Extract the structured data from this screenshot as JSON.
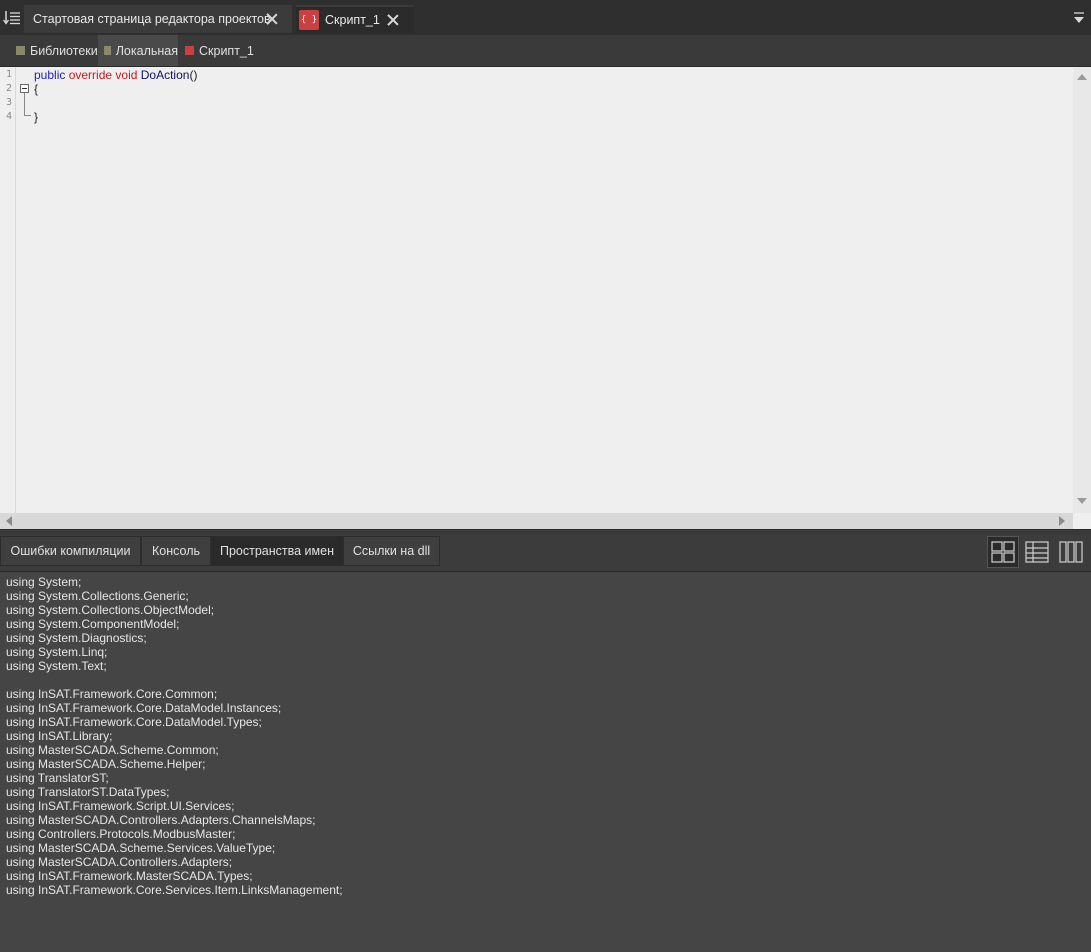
{
  "tabs": {
    "start_page_label": "Стартовая страница редактора проектов",
    "script_label": "Скрипт_1"
  },
  "breadcrumb": {
    "items": [
      {
        "label": "Библиотеки",
        "color": "#8a8a6a"
      },
      {
        "label": "Локальная",
        "color": "#8a8a6a"
      },
      {
        "label": "Скрипт_1",
        "color": "#c94040"
      }
    ]
  },
  "editor": {
    "line_numbers": [
      "1",
      "2",
      "3",
      "4"
    ],
    "code": {
      "kw_public": "public",
      "kw_override_void": "override void",
      "method_name": "DoAction",
      "parens": "()",
      "open_brace": "{",
      "close_brace": "}"
    }
  },
  "bottom_panel": {
    "tabs": [
      "Ошибки компиляции",
      "Консоль",
      "Пространства имен",
      "Ссылки на dll"
    ],
    "active_tab": "Пространства имен",
    "view_buttons": [
      "grid-view-icon",
      "table-view-icon",
      "columns-view-icon"
    ]
  },
  "namespaces": [
    "using System;",
    "using System.Collections.Generic;",
    "using System.Collections.ObjectModel;",
    "using System.ComponentModel;",
    "using System.Diagnostics;",
    "using System.Linq;",
    "using System.Text;",
    "",
    "using InSAT.Framework.Core.Common;",
    "using InSAT.Framework.Core.DataModel.Instances;",
    "using InSAT.Framework.Core.DataModel.Types;",
    "using InSAT.Library;",
    "using MasterSCADA.Scheme.Common;",
    "using MasterSCADA.Scheme.Helper;",
    "using TranslatorST;",
    "using TranslatorST.DataTypes;",
    "using InSAT.Framework.Script.UI.Services;",
    "using MasterSCADA.Controllers.Adapters.ChannelsMaps;",
    "using Controllers.Protocols.ModbusMaster;",
    "using MasterSCADA.Scheme.Services.ValueType;",
    "using MasterSCADA.Controllers.Adapters;",
    "using InSAT.Framework.MasterSCADA.Types;",
    "using InSAT.Framework.Core.Services.Item.LinksManagement;"
  ]
}
